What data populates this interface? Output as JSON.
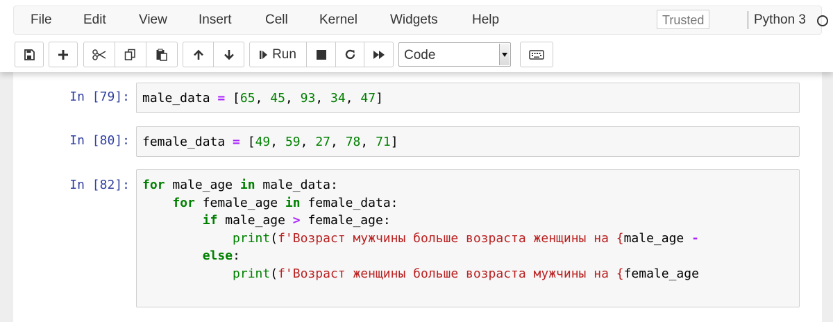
{
  "menubar": {
    "items": [
      "File",
      "Edit",
      "View",
      "Insert",
      "Cell",
      "Kernel",
      "Widgets",
      "Help"
    ],
    "trusted_label": "Trusted",
    "kernel_name": "Python 3"
  },
  "toolbar": {
    "run_label": "Run",
    "cell_type": "Code"
  },
  "cells": [
    {
      "prompt": "In [79]:",
      "lines": [
        [
          [
            "",
            "male_data "
          ],
          [
            "op",
            "="
          ],
          [
            "",
            " ["
          ],
          [
            "num",
            "65"
          ],
          [
            "",
            ", "
          ],
          [
            "num",
            "45"
          ],
          [
            "",
            ", "
          ],
          [
            "num",
            "93"
          ],
          [
            "",
            ", "
          ],
          [
            "num",
            "34"
          ],
          [
            "",
            ", "
          ],
          [
            "num",
            "47"
          ],
          [
            "",
            "]"
          ]
        ]
      ]
    },
    {
      "prompt": "In [80]:",
      "lines": [
        [
          [
            "",
            "female_data "
          ],
          [
            "op",
            "="
          ],
          [
            "",
            " ["
          ],
          [
            "num",
            "49"
          ],
          [
            "",
            ", "
          ],
          [
            "num",
            "59"
          ],
          [
            "",
            ", "
          ],
          [
            "num",
            "27"
          ],
          [
            "",
            ", "
          ],
          [
            "num",
            "78"
          ],
          [
            "",
            ", "
          ],
          [
            "num",
            "71"
          ],
          [
            "",
            "]"
          ]
        ]
      ]
    },
    {
      "prompt": "In [82]:",
      "lines": [
        [
          [
            "kw",
            "for"
          ],
          [
            "",
            " male_age "
          ],
          [
            "kw",
            "in"
          ],
          [
            "",
            " male_data:"
          ]
        ],
        [
          [
            "",
            "    "
          ],
          [
            "kw",
            "for"
          ],
          [
            "",
            " female_age "
          ],
          [
            "kw",
            "in"
          ],
          [
            "",
            " female_data:"
          ]
        ],
        [
          [
            "",
            "        "
          ],
          [
            "kw",
            "if"
          ],
          [
            "",
            " male_age "
          ],
          [
            "op",
            ">"
          ],
          [
            "",
            " female_age:"
          ]
        ],
        [
          [
            "",
            "            "
          ],
          [
            "bi",
            "print"
          ],
          [
            "",
            "("
          ],
          [
            "str",
            "f'Возраст мужчины больше возраста женщины на {"
          ],
          [
            "",
            "male_age "
          ],
          [
            "op",
            "-"
          ]
        ],
        [
          [
            "",
            "        "
          ],
          [
            "kw",
            "else"
          ],
          [
            "",
            ":"
          ]
        ],
        [
          [
            "",
            "            "
          ],
          [
            "bi",
            "print"
          ],
          [
            "",
            "("
          ],
          [
            "str",
            "f'Возраст женщины больше возраста мужчины на {"
          ],
          [
            "",
            "female_age"
          ]
        ]
      ]
    }
  ]
}
